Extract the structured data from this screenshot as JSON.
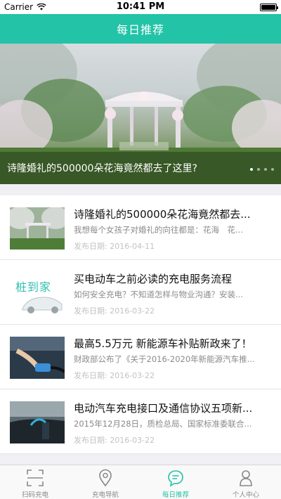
{
  "status_bar": {
    "carrier": "Carrier",
    "time": "10:41 PM"
  },
  "nav": {
    "title": "每日推荐"
  },
  "banner": {
    "caption": "诗隆婚礼的500000朵花海竟然都去了这里?",
    "page_count": 4,
    "active_page": 1
  },
  "news": [
    {
      "title": "诗隆婚礼的500000朵花海竟然都去...",
      "summary": "我想每个女孩子对婚礼的向往都是：花海　花...",
      "date": "发布日期: 2016-04-11",
      "thumb_icon": "wedding-flowers-thumbnail"
    },
    {
      "title": "买电动车之前必读的充电服务流程",
      "summary": "如何安全充电？不知道怎样与物业沟通？安装...",
      "date": "发布日期: 2016-03-22",
      "thumb_icon": "zhuangdaojia-logo-thumbnail",
      "thumb_text": "桩到家"
    },
    {
      "title": "最高5.5万元 新能源车补贴新政来了！",
      "summary": "财政部公布了《关于2016-2020年新能源汽车推...",
      "date": "发布日期: 2016-03-22",
      "thumb_icon": "ev-charging-plug-thumbnail"
    },
    {
      "title": "电动汽车充电接口及通信协议五项新...",
      "summary": "2015年12月28日，质检总局、国家标准委联合...",
      "date": "发布日期: 2016-03-22",
      "thumb_icon": "ev-charging-station-thumbnail"
    }
  ],
  "tabs": [
    {
      "label": "扫码充电",
      "icon": "scan-icon",
      "active": false
    },
    {
      "label": "充电导航",
      "icon": "map-pin-icon",
      "active": false
    },
    {
      "label": "每日推荐",
      "icon": "chat-bubble-icon",
      "active": true
    },
    {
      "label": "个人中心",
      "icon": "person-icon",
      "active": false
    }
  ],
  "colors": {
    "accent": "#22c3a7",
    "inactive": "#888888"
  }
}
